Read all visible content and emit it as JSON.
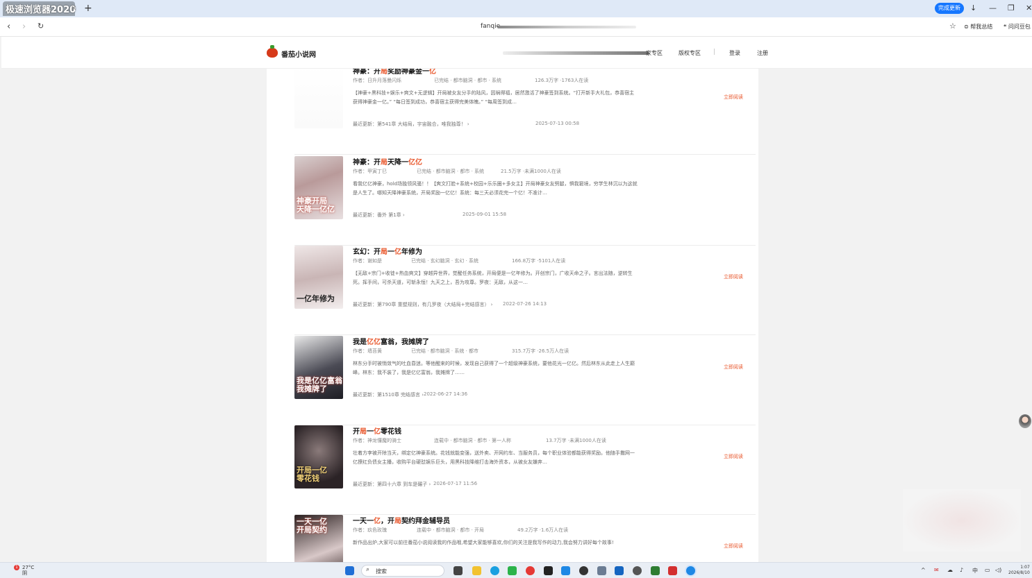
{
  "browser": {
    "tab_title": "极速浏览器2020",
    "update_button": "完成更新",
    "url": "fanqie",
    "tools": [
      "帮我总结",
      "问问豆包"
    ]
  },
  "site": {
    "name": "番茄小说网",
    "nav": [
      "家专区",
      "版权专区",
      "登录",
      "注册"
    ]
  },
  "books": [
    {
      "title_parts": [
        "神豪：开",
        "局",
        "奖励神豪金一",
        "亿",
        ""
      ],
      "author": "作者：日升月落曼闪烁",
      "status_tags": "已完结 · 都市脑洞 · 都市 · 系统",
      "stats": "126.3万字 ·1763人在读",
      "desc": "【神豪+黑科技+娱乐+爽文+无逻辑】开局被女友分手的陆风，因祸得福，居然激活了神豪签到系统。“打开新手大礼包，恭喜宿主获得神豪金一亿。” “每日签到成功，恭喜宿主获得完美体魄。” “每周签到成…",
      "latest": "最近更新：第541章 大结局，宇宙融合，唯我独尊！ ›",
      "time": "2025-07-13 00:58",
      "read": "立即阅读"
    },
    {
      "title_parts": [
        "神豪：开",
        "局",
        "天降一",
        "亿亿",
        ""
      ],
      "author": "作者：甲寅丁巳",
      "status_tags": "已完结 · 都市脑洞 · 都市 · 系统",
      "stats": "21.5万字 ·未满1000人在读",
      "desc": "看我亿亿神豪，hold场独领风骚！！【爽文打脸+系统+校园+乐乐圈+多女主】开局神豪女友劈腿，惧我窘境，穷学生林沉以为这就是人生了。哪知天降神豪系统，开局奖励一亿亿！系统：每三天必须花完一个亿！不准计…",
      "latest": "最近更新：番外 第1章 ›",
      "time": "2025-09-01 15:58",
      "read": ""
    },
    {
      "title_parts": [
        "玄幻：开",
        "局",
        "一",
        "亿",
        "年修为"
      ],
      "author": "作者：谢如是",
      "status_tags": "已完结 · 玄幻脑洞 · 玄幻 · 系统",
      "stats": "166.8万字 ·5101人在读",
      "desc": "【无敌+宗门+收徒+热血爽文】穿越异世界，觉醒任务系统，开局便是一亿年修为。开创宗门，广收天命之子。言出法随，逆转生死。挥手间，可杀天道，可斩永恒！九天之上，吾为攻尊。罗夜：无敌，从这一…",
      "latest": "最近更新：第790章 重塑规则，有几罗夜（大结局+完结感言） ›",
      "time": "2022-07-26 14:13",
      "read": "立即阅读"
    },
    {
      "title_parts": [
        "我是",
        "亿亿",
        "富翁，我摊牌了",
        "",
        ""
      ],
      "author": "作者：墙苔黄",
      "status_tags": "已完结 · 都市脑洞 · 系统 · 都市",
      "stats": "315.7万字 ·26.5万人在读",
      "desc": "林东分手时被悄敛气的吐血昏迷。等他醒来的时候，发现自己获得了一个超级神豪系统，要他花光一亿亿。然后林东从此走上人生巅峰。林东：我不装了，我是亿亿富翁，我摊牌了……",
      "latest": "最近更新：第1510章 完结感言 ›",
      "time": "2022-06-27 14:36",
      "read": "立即阅读"
    },
    {
      "title_parts": [
        "开",
        "局",
        "一",
        "亿",
        "零花钱"
      ],
      "author": "作者：神龙懂魔的骑士",
      "status_tags": "连载中 · 都市脑洞 · 都市 · 第一人称",
      "stats": "13.7万字 ·未满1000人在读",
      "desc": "壮着方李被开除当天，绑定亿神豪系统。花钱就能变强，送外卖、开网约车、当服务员，每个职业体验都能获得奖励。他随手撒网一亿撩红负债女主播，收购平台硬怼娱乐巨头，用黑科技降维打击海外资本，从被女友嫌弃…",
      "latest": "最近更新：第四十六章 到车是碾子 ›",
      "time": "2026-07-17 11:56",
      "read": "立即阅读"
    },
    {
      "title_parts": [
        "一天一",
        "亿",
        "，开",
        "局",
        "契约拜金辅导员"
      ],
      "author": "作者：玖色玫瑰",
      "status_tags": "连载中 · 都市脑洞 · 都市 · 开局",
      "stats": "49.2万字 ·1.6万人在读",
      "desc": "新作品出炉,大家可以前往番茄小说阅读我的作品哦,希望大家能够喜欢,你们的关注是我写作的动力,我会努力讲好每个故事!",
      "latest": "",
      "time": "",
      "read": "立即阅读"
    }
  ],
  "cover_texts": [
    "",
    "神豪开局\n天降一亿亿",
    "一亿年修为",
    "我是亿亿富翁\n我摊牌了",
    "开局一亿\n零花钱",
    "一天一亿\n开局契约"
  ],
  "taskbar": {
    "weather_temp": "27°C",
    "weather_desc": "阴",
    "badge": "1",
    "search": "搜索",
    "ime": "中",
    "time": "1:07",
    "date": "2026/8/10"
  }
}
